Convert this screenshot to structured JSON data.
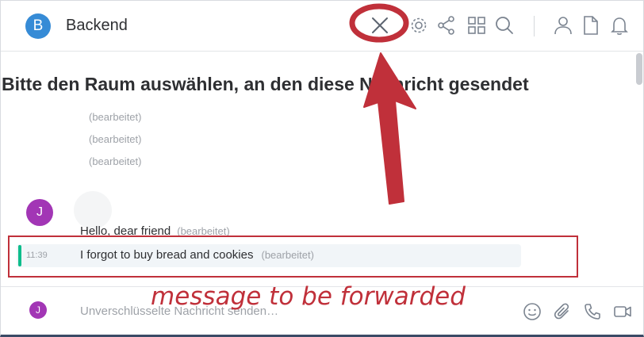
{
  "header": {
    "avatar_letter": "B",
    "room_name": "Backend",
    "icons": [
      "close-icon",
      "settings-icon",
      "share-icon",
      "widgets-icon",
      "search-icon",
      "member-icon",
      "files-icon",
      "notification-icon"
    ]
  },
  "timeline": {
    "heading": "Bitte den Raum auswählen, an den diese Nachricht gesendet",
    "edited_label": "(bearbeitet)",
    "sender_avatar_letter": "J",
    "messages": [
      {
        "text": "Hello, dear friend",
        "edited": "(bearbeitet)"
      },
      {
        "time": "11:39",
        "text": "I forgot to buy bread and cookies",
        "edited": "(bearbeitet)"
      }
    ]
  },
  "composer": {
    "avatar_letter": "J",
    "placeholder": "Unverschlüsselte Nachricht senden…",
    "icons": [
      "emoji-icon",
      "attachment-icon",
      "voice-call-icon",
      "video-call-icon"
    ]
  },
  "annotation": {
    "label": "message to be forwarded",
    "color": "#c0303a"
  },
  "colors": {
    "room_avatar": "#368bd6",
    "user_avatar": "#a236b5",
    "selected_bar": "#0dbd8b"
  }
}
